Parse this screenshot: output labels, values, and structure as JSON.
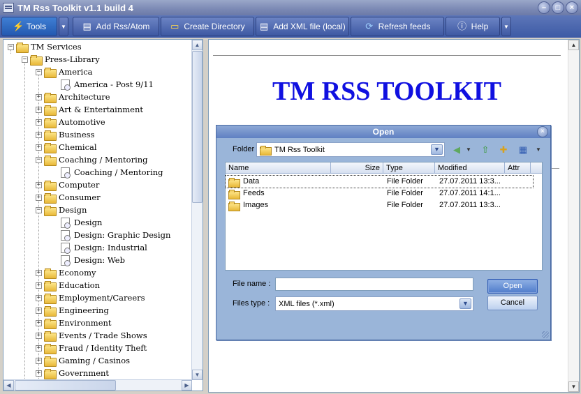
{
  "window": {
    "title": "TM Rss Toolkit v1.1 build 4"
  },
  "toolbar": {
    "tools": "Tools",
    "add_rss": "Add Rss/Atom",
    "create_dir": "Create Directory",
    "add_xml": "Add XML file (local)",
    "refresh": "Refresh feeds",
    "help": "Help"
  },
  "tree": {
    "root": "TM Services",
    "library": "Press-Library",
    "items": [
      {
        "label": "America",
        "type": "folder",
        "level": 2,
        "expander": "−"
      },
      {
        "label": "America - Post 9/11",
        "type": "doc",
        "level": 3,
        "expander": ""
      },
      {
        "label": "Architecture",
        "type": "folder",
        "level": 2,
        "expander": "+"
      },
      {
        "label": "Art & Entertainment",
        "type": "folder",
        "level": 2,
        "expander": "+"
      },
      {
        "label": "Automotive",
        "type": "folder",
        "level": 2,
        "expander": "+"
      },
      {
        "label": "Business",
        "type": "folder",
        "level": 2,
        "expander": "+"
      },
      {
        "label": "Chemical",
        "type": "folder",
        "level": 2,
        "expander": "+"
      },
      {
        "label": "Coaching / Mentoring",
        "type": "folder",
        "level": 2,
        "expander": "−"
      },
      {
        "label": "Coaching / Mentoring",
        "type": "doc",
        "level": 3,
        "expander": ""
      },
      {
        "label": "Computer",
        "type": "folder",
        "level": 2,
        "expander": "+"
      },
      {
        "label": "Consumer",
        "type": "folder",
        "level": 2,
        "expander": "+"
      },
      {
        "label": "Design",
        "type": "folder",
        "level": 2,
        "expander": "−"
      },
      {
        "label": "Design",
        "type": "doc",
        "level": 3,
        "expander": ""
      },
      {
        "label": "Design: Graphic Design",
        "type": "doc",
        "level": 3,
        "expander": ""
      },
      {
        "label": "Design: Industrial",
        "type": "doc",
        "level": 3,
        "expander": ""
      },
      {
        "label": "Design: Web",
        "type": "doc",
        "level": 3,
        "expander": ""
      },
      {
        "label": "Economy",
        "type": "folder",
        "level": 2,
        "expander": "+"
      },
      {
        "label": "Education",
        "type": "folder",
        "level": 2,
        "expander": "+"
      },
      {
        "label": "Employment/Careers",
        "type": "folder",
        "level": 2,
        "expander": "+"
      },
      {
        "label": "Engineering",
        "type": "folder",
        "level": 2,
        "expander": "+"
      },
      {
        "label": "Environment",
        "type": "folder",
        "level": 2,
        "expander": "+"
      },
      {
        "label": "Events / Trade Shows",
        "type": "folder",
        "level": 2,
        "expander": "+"
      },
      {
        "label": "Fraud / Identity Theft",
        "type": "folder",
        "level": 2,
        "expander": "+"
      },
      {
        "label": "Gaming / Casinos",
        "type": "folder",
        "level": 2,
        "expander": "+"
      },
      {
        "label": "Government",
        "type": "folder",
        "level": 2,
        "expander": "+"
      }
    ]
  },
  "page": {
    "heading": "TM RSS TOOLKIT"
  },
  "dialog": {
    "title": "Open",
    "folder_label": "Folder",
    "folder_value": "TM Rss Toolkit",
    "columns": [
      "Name",
      "Size",
      "Type",
      "Modified",
      "Attr"
    ],
    "files": [
      {
        "name": "Data",
        "type": "File Folder",
        "modified": "27.07.2011 13:3..."
      },
      {
        "name": "Feeds",
        "type": "File Folder",
        "modified": "27.07.2011 14:1..."
      },
      {
        "name": "Images",
        "type": "File Folder",
        "modified": "27.07.2011 13:3..."
      }
    ],
    "filename_label": "File name :",
    "filename_value": "",
    "filetype_label": "Files type :",
    "filetype_value": "XML files (*.xml)",
    "open_button": "Open",
    "cancel_button": "Cancel"
  }
}
